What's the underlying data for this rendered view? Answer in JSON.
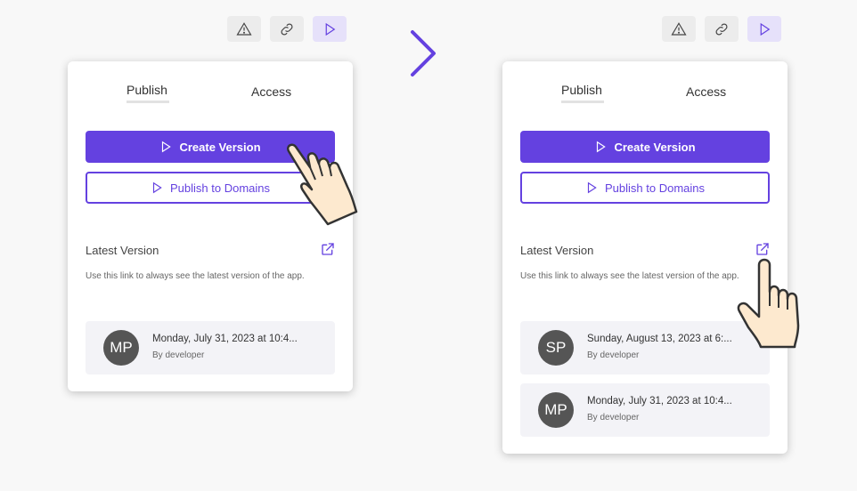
{
  "left": {
    "tabs": [
      "Publish",
      "Access"
    ],
    "create_version_label": "Create Version",
    "publish_domains_label": "Publish to Domains",
    "latest_version_title": "Latest Version",
    "latest_version_desc": "Use this link to always see the latest version of the app.",
    "versions": [
      {
        "initials": "MP",
        "date": "Monday, July 31, 2023 at 10:4...",
        "by": "By developer"
      }
    ]
  },
  "right": {
    "tabs": [
      "Publish",
      "Access"
    ],
    "create_version_label": "Create Version",
    "publish_domains_label": "Publish to Domains",
    "latest_version_title": "Latest Version",
    "latest_version_desc": "Use this link to always see the latest version of the app.",
    "versions": [
      {
        "initials": "SP",
        "date": "Sunday, August 13, 2023 at 6:...",
        "by": "By developer"
      },
      {
        "initials": "MP",
        "date": "Monday, July 31, 2023 at 10:4...",
        "by": "By developer"
      }
    ]
  },
  "toolbar_icons": [
    "warning-icon",
    "link-icon",
    "play-icon"
  ],
  "colors": {
    "accent": "#6441e0",
    "card_bg": "#f3f3f7",
    "avatar_bg": "#555555"
  }
}
